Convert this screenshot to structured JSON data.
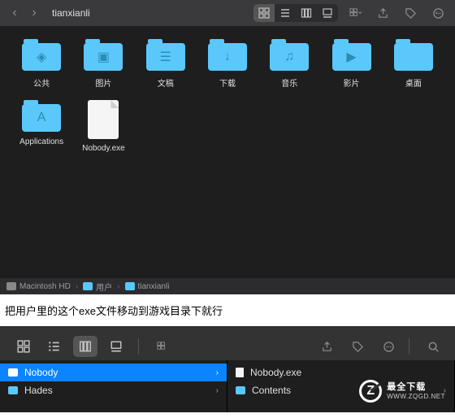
{
  "window1": {
    "title": "tianxianli",
    "nav_back": "‹",
    "nav_forward": "›",
    "folders": [
      {
        "label": "公共",
        "glyph": "◈"
      },
      {
        "label": "图片",
        "glyph": "▣"
      },
      {
        "label": "文稿",
        "glyph": "☰"
      },
      {
        "label": "下载",
        "glyph": "↓"
      },
      {
        "label": "音乐",
        "glyph": "♫"
      },
      {
        "label": "影片",
        "glyph": "▶"
      },
      {
        "label": "桌面",
        "glyph": ""
      },
      {
        "label": "Applications",
        "glyph": "A"
      }
    ],
    "files": [
      {
        "label": "Nobody.exe"
      }
    ],
    "path": [
      {
        "label": "Macintosh HD",
        "type": "hd"
      },
      {
        "label": "用户",
        "type": "folder"
      },
      {
        "label": "tianxianli",
        "type": "folder"
      }
    ]
  },
  "caption": "把用户里的这个exe文件移动到游戏目录下就行",
  "window2": {
    "left_column": [
      {
        "label": "Nobody",
        "selected": true,
        "has_children": true
      },
      {
        "label": "Hades",
        "selected": false,
        "has_children": true
      }
    ],
    "right_column": [
      {
        "label": "Nobody.exe",
        "type": "file"
      },
      {
        "label": "Contents",
        "type": "folder",
        "has_children": true
      }
    ]
  },
  "watermark": {
    "line1": "最全下载",
    "line2": "WWW.ZQGD.NET"
  }
}
